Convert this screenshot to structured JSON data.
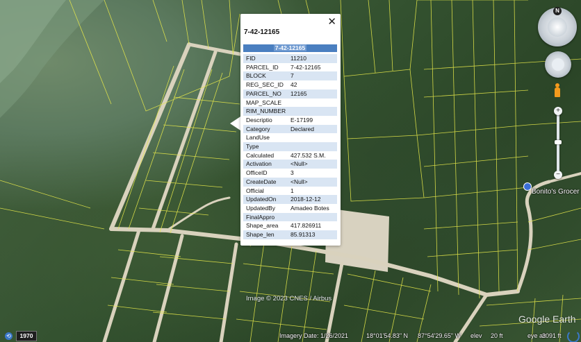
{
  "popup": {
    "title": "7-42-12165",
    "header": "7-42-12165",
    "close_glyph": "✕",
    "rows": [
      {
        "key": "FID",
        "value": "11210"
      },
      {
        "key": "PARCEL_ID",
        "value": "7-42-12165"
      },
      {
        "key": "BLOCK",
        "value": "7"
      },
      {
        "key": "REG_SEC_ID",
        "value": "42"
      },
      {
        "key": "PARCEL_NO",
        "value": "12165"
      },
      {
        "key": "MAP_SCALE",
        "value": ""
      },
      {
        "key": "RIM_NUMBER",
        "value": ""
      },
      {
        "key": "Descriptio",
        "value": "E-17199"
      },
      {
        "key": "Category",
        "value": "Declared"
      },
      {
        "key": "LandUse",
        "value": ""
      },
      {
        "key": "Type",
        "value": ""
      },
      {
        "key": "Calculated",
        "value": "427.532 S.M."
      },
      {
        "key": "Activation",
        "value": "<Null>"
      },
      {
        "key": "OfficeID",
        "value": "3"
      },
      {
        "key": "CreateDate",
        "value": "<Null>"
      },
      {
        "key": "Official",
        "value": "1"
      },
      {
        "key": "UpdatedOn",
        "value": "2018-12-12"
      },
      {
        "key": "UpdatedBy",
        "value": "Amadeo Botes"
      },
      {
        "key": "FinalAppro",
        "value": ""
      },
      {
        "key": "Shape_area",
        "value": "417.826911"
      },
      {
        "key": "Shape_len",
        "value": "85.91313"
      }
    ]
  },
  "map": {
    "place_label": "Bonito's Grocer",
    "copyright": "Image © 2023 CNES / Airbus",
    "brand": "Google Earth"
  },
  "navigation": {
    "north_label": "N",
    "zoom_in": "+",
    "zoom_out": "−"
  },
  "status": {
    "year": "1970",
    "imagery_date": "Imagery Date: 1/26/2021",
    "latitude": "18°01'54.83\" N",
    "longitude": "87°54'29.65\" W",
    "elev": "elev",
    "elev_value": "20 ft",
    "eye_alt": "eye alt",
    "eye_alt_value": "3091 ft"
  },
  "colors": {
    "parcel_lines": "#e6e84a",
    "road": "#d9d2bd",
    "popup_header": "#4a7fc0",
    "row_shade": "#d9e5f3"
  },
  "icons": {
    "history": "clock-icon",
    "close": "close-icon",
    "compass": "compass-icon",
    "pegman": "pegman-icon",
    "place": "shop-icon"
  }
}
